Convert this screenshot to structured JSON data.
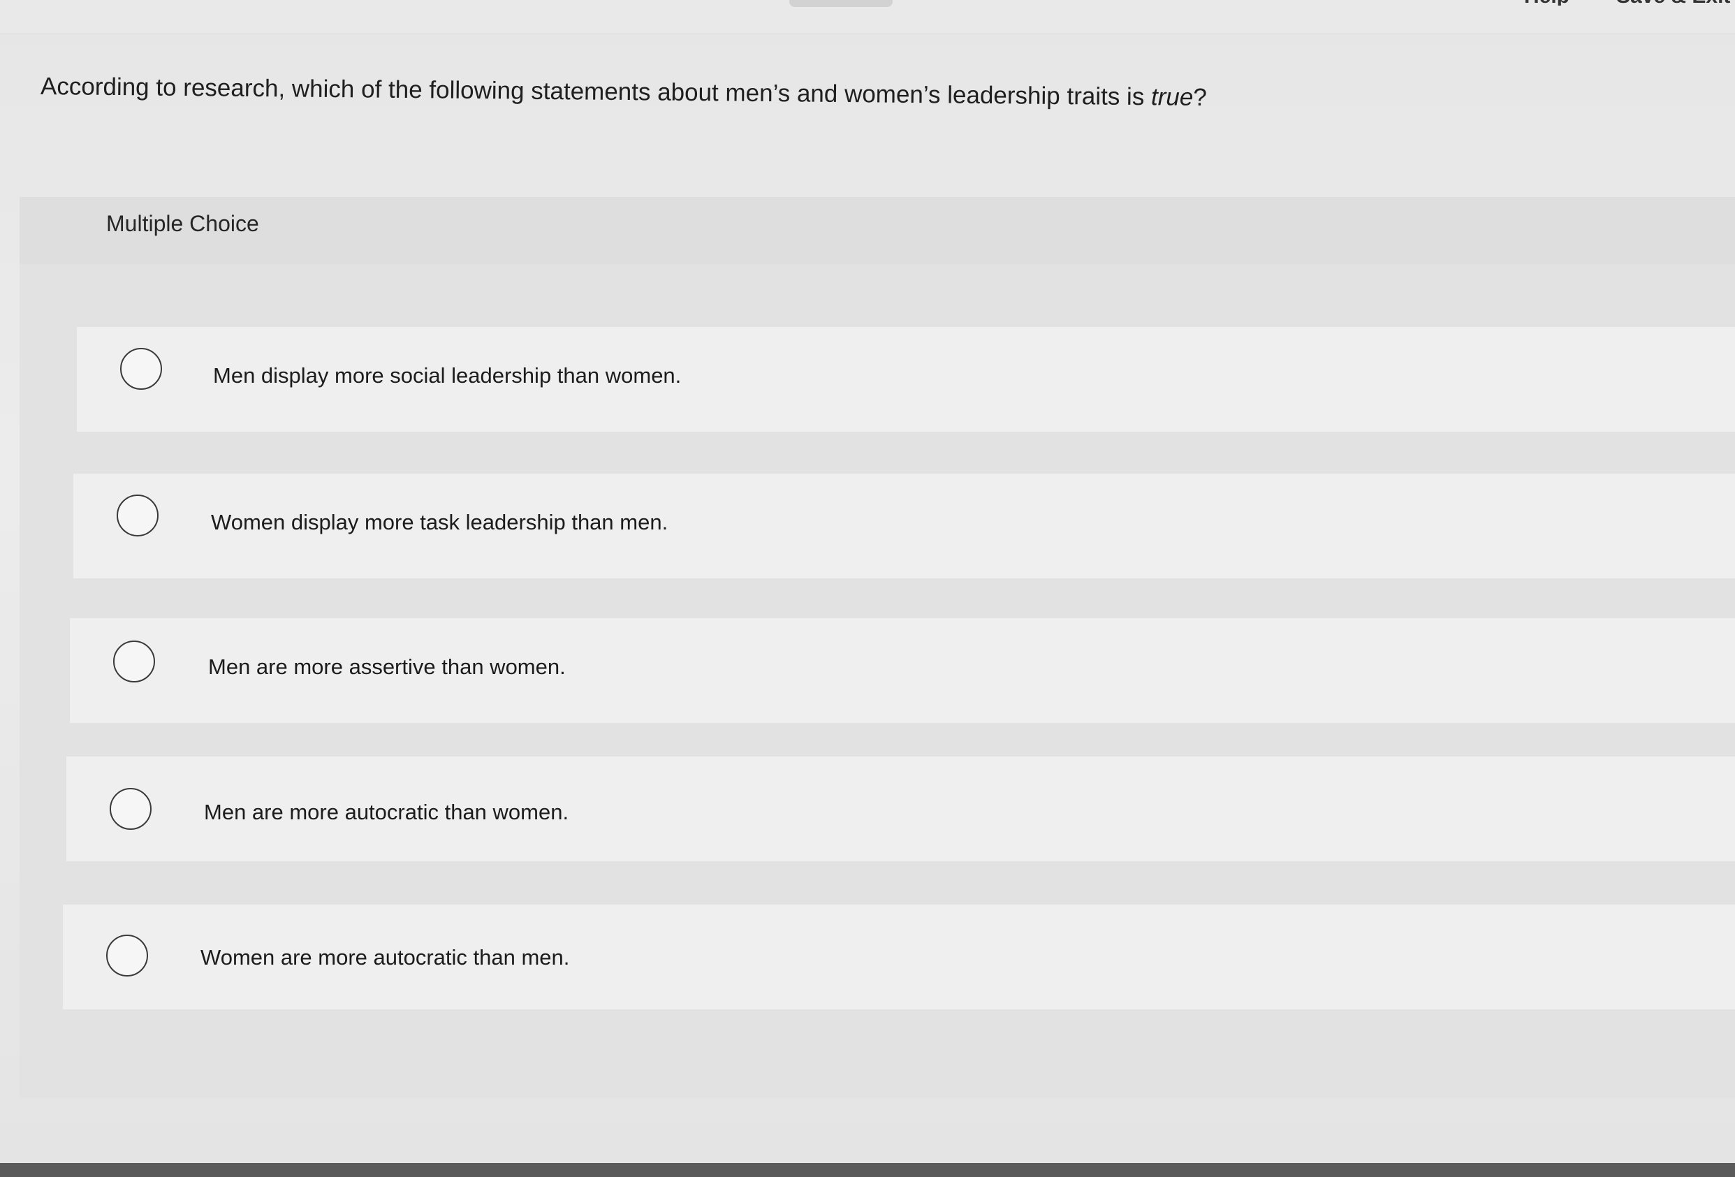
{
  "header": {
    "right_links": [
      "Help",
      "Save & Exit"
    ]
  },
  "question": {
    "prefix": "According to research, which of the following statements about men’s and women’s leadership traits is ",
    "emphasis": "true",
    "suffix": "?"
  },
  "multiple_choice": {
    "label": "Multiple Choice",
    "options": [
      {
        "text": "Men display more social leadership than women.",
        "selected": false
      },
      {
        "text": "Women display more task leadership than men.",
        "selected": false
      },
      {
        "text": "Men are more assertive than women.",
        "selected": false
      },
      {
        "text": "Men are more autocratic than women.",
        "selected": false
      },
      {
        "text": "Women are more autocratic than men.",
        "selected": false
      }
    ]
  }
}
